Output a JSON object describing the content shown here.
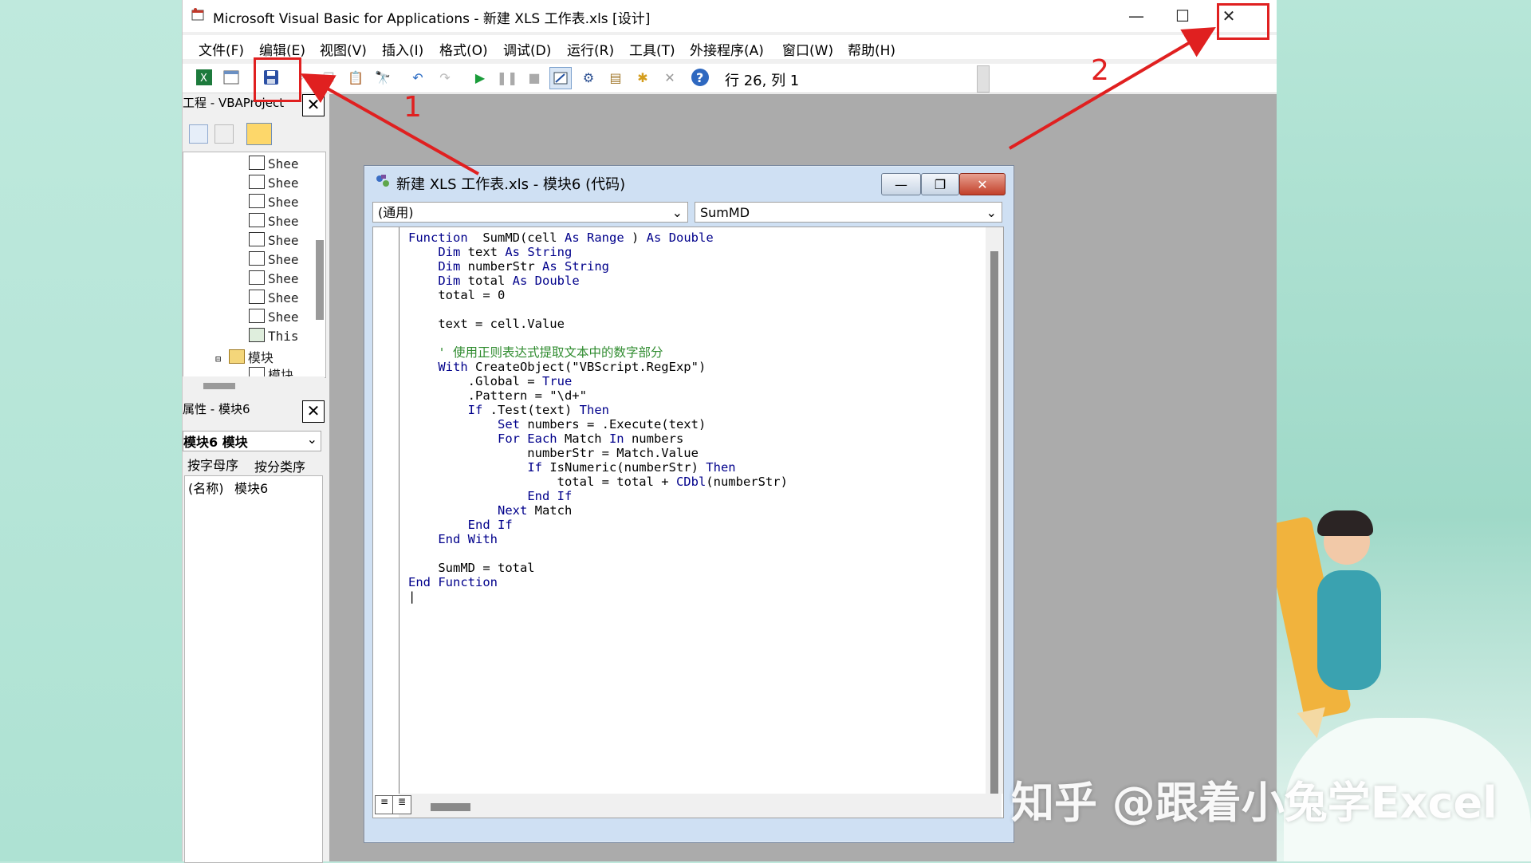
{
  "window": {
    "title": "Microsoft Visual Basic for Applications - 新建 XLS 工作表.xls [设计]",
    "minimize": "—",
    "maximize": "☐",
    "close": "✕"
  },
  "menu": [
    "文件(F)",
    "编辑(E)",
    "视图(V)",
    "插入(I)",
    "格式(O)",
    "调试(D)",
    "运行(R)",
    "工具(T)",
    "外接程序(A)",
    "窗口(W)",
    "帮助(H)"
  ],
  "toolbar": {
    "icons": [
      "excel-icon",
      "insert-userform-icon",
      "save-icon",
      "cut-icon",
      "copy-icon",
      "paste-icon",
      "find-icon",
      "undo-icon",
      "redo-icon",
      "run-icon",
      "break-icon",
      "reset-icon",
      "design-mode-icon",
      "project-explorer-icon",
      "properties-window-icon",
      "object-browser-icon",
      "toolbox-icon",
      "help-icon"
    ],
    "position": "行 26, 列 1"
  },
  "project": {
    "title": "工程 - VBAProject",
    "close": "✕",
    "items": [
      "Shee",
      "Shee",
      "Shee",
      "Shee",
      "Shee",
      "Shee",
      "Shee",
      "Shee",
      "Shee",
      "This",
      "模块",
      "模块"
    ]
  },
  "properties": {
    "title": "属性 - 模块6",
    "close": "✕",
    "object": "模块6 模块",
    "tabs": [
      "按字母序",
      "按分类序"
    ],
    "row_name": "(名称)",
    "row_value": "模块6"
  },
  "code_window": {
    "title": "新建 XLS 工作表.xls - 模块6 (代码)",
    "object_combo": "(通用)",
    "proc_combo": "SumMD",
    "lines": [
      [
        [
          "kw",
          "Function"
        ],
        [
          "",
          "  SumMD(cell "
        ],
        [
          "kw",
          "As"
        ],
        [
          "",
          "",
          " "
        ],
        [
          "kw",
          "Range"
        ],
        [
          "",
          " ) "
        ],
        [
          "kw",
          "As"
        ],
        [
          "",
          " "
        ],
        [
          "kw",
          "Double"
        ]
      ],
      [
        [
          "",
          "    "
        ],
        [
          "kw",
          "Dim"
        ],
        [
          "",
          " text "
        ],
        [
          "kw",
          "As"
        ],
        [
          "",
          " "
        ],
        [
          "kw",
          "String"
        ]
      ],
      [
        [
          "",
          "    "
        ],
        [
          "kw",
          "Dim"
        ],
        [
          "",
          " numberStr "
        ],
        [
          "kw",
          "As"
        ],
        [
          "",
          " "
        ],
        [
          "kw",
          "String"
        ]
      ],
      [
        [
          "",
          "    "
        ],
        [
          "kw",
          "Dim"
        ],
        [
          "",
          " total "
        ],
        [
          "kw",
          "As"
        ],
        [
          "",
          " "
        ],
        [
          "kw",
          "Double"
        ]
      ],
      [
        [
          "",
          "    total = 0"
        ]
      ],
      [
        [
          "",
          ""
        ]
      ],
      [
        [
          "",
          "    text = cell.Value"
        ]
      ],
      [
        [
          "",
          ""
        ]
      ],
      [
        [
          "cm",
          "    ' 使用正则表达式提取文本中的数字部分"
        ]
      ],
      [
        [
          "",
          "    "
        ],
        [
          "kw",
          "With"
        ],
        [
          "",
          " CreateObject(\"VBScript.RegExp\")"
        ]
      ],
      [
        [
          "",
          "        .Global = "
        ],
        [
          "kw",
          "True"
        ]
      ],
      [
        [
          "",
          "        .Pattern = \"\\d+\""
        ]
      ],
      [
        [
          "",
          "        "
        ],
        [
          "kw",
          "If"
        ],
        [
          "",
          " .Test(text) "
        ],
        [
          "kw",
          "Then"
        ]
      ],
      [
        [
          "",
          "            "
        ],
        [
          "kw",
          "Set"
        ],
        [
          "",
          " numbers = .Execute(text)"
        ]
      ],
      [
        [
          "",
          "            "
        ],
        [
          "kw",
          "For Each"
        ],
        [
          "",
          " Match "
        ],
        [
          "kw",
          "In"
        ],
        [
          "",
          " numbers"
        ]
      ],
      [
        [
          "",
          "                numberStr = Match.Value"
        ]
      ],
      [
        [
          "",
          "                "
        ],
        [
          "kw",
          "If"
        ],
        [
          "",
          " IsNumeric(numberStr) "
        ],
        [
          "kw",
          "Then"
        ]
      ],
      [
        [
          "",
          "                    total = total + "
        ],
        [
          "kw",
          "CDbl"
        ],
        [
          "",
          "(numberStr)"
        ]
      ],
      [
        [
          "",
          "                "
        ],
        [
          "kw",
          "End If"
        ]
      ],
      [
        [
          "",
          "            "
        ],
        [
          "kw",
          "Next"
        ],
        [
          "",
          " Match"
        ]
      ],
      [
        [
          "",
          "        "
        ],
        [
          "kw",
          "End If"
        ]
      ],
      [
        [
          "",
          "    "
        ],
        [
          "kw",
          "End With"
        ]
      ],
      [
        [
          "",
          ""
        ]
      ],
      [
        [
          "",
          "    SumMD = total"
        ]
      ],
      [
        [
          "kw",
          "End Function"
        ]
      ],
      [
        [
          "",
          "|"
        ]
      ]
    ]
  },
  "annotations": {
    "label1": "1",
    "label2": "2",
    "color": "#e02020"
  },
  "watermark": "知乎 @跟着小兔学Excel"
}
